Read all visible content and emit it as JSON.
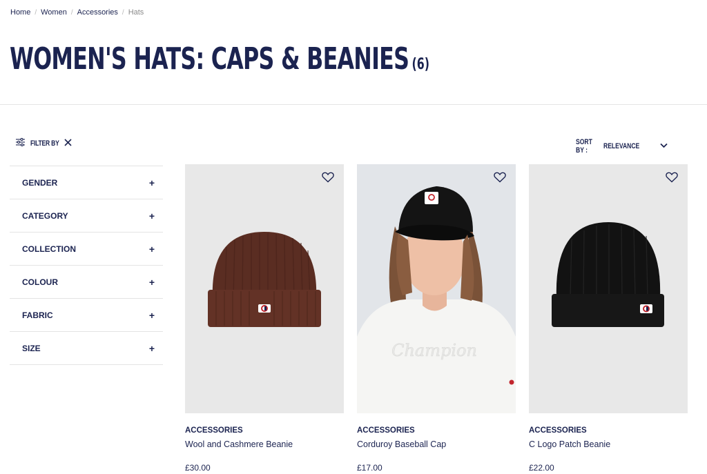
{
  "breadcrumb": {
    "items": [
      "Home",
      "Women",
      "Accessories"
    ],
    "current": "Hats",
    "separator": "/"
  },
  "page": {
    "title": "WOMEN'S HATS: CAPS & BEANIES",
    "count": "(6)"
  },
  "toolbar": {
    "filter_label": "FILTER BY",
    "sort_label": "SORT BY :",
    "sort_value": "RELEVANCE"
  },
  "facets": [
    {
      "label": "GENDER",
      "icon": "+"
    },
    {
      "label": "CATEGORY",
      "icon": "+"
    },
    {
      "label": "COLLECTION",
      "icon": "+"
    },
    {
      "label": "COLOUR",
      "icon": "+"
    },
    {
      "label": "FABRIC",
      "icon": "+"
    },
    {
      "label": "SIZE",
      "icon": "+"
    }
  ],
  "products": [
    {
      "category": "ACCESSORIES",
      "name": "Wool and Cashmere Beanie",
      "price": "£30.00",
      "image": "brown-beanie",
      "wishlist_icon": "heart-icon"
    },
    {
      "category": "ACCESSORIES",
      "name": "Corduroy Baseball Cap",
      "price": "£17.00",
      "image": "model-wearing-black-cap",
      "wishlist_icon": "heart-icon"
    },
    {
      "category": "ACCESSORIES",
      "name": "C Logo Patch Beanie",
      "price": "£22.00",
      "image": "black-beanie",
      "wishlist_icon": "heart-icon"
    }
  ],
  "colors": {
    "navy": "#1b2350",
    "image_bg": "#e8e8e8",
    "brown": "#5a2d22",
    "black": "#121212"
  }
}
